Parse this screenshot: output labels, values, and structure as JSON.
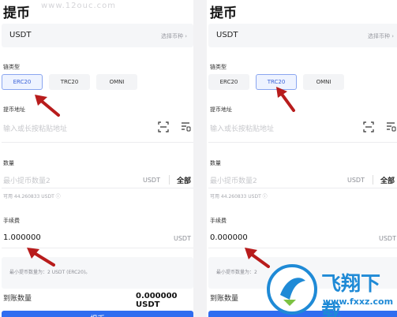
{
  "watermark": "www.12ouc.com",
  "panels": [
    {
      "title": "提币",
      "coin": {
        "value": "USDT",
        "choose_label": "选择币种 ›"
      },
      "chain_label": "链类型",
      "chains": [
        "ERC20",
        "TRC20",
        "OMNI"
      ],
      "active_chain": "ERC20",
      "address_label": "提币地址",
      "address_placeholder": "输入或长按粘贴地址",
      "amount_label": "数量",
      "amount_placeholder": "最小提币数量2",
      "amount_unit": "USDT",
      "all_label": "全部",
      "available_text": "可用 44.260833 USDT ⓘ",
      "fee_label": "手续费",
      "fee_value": "1.000000",
      "fee_unit": "USDT",
      "note_text": "最小提币数量为：2 USDT (ERC20)。",
      "receive_label": "到账数量",
      "receive_value": "0.000000 USDT",
      "submit_label": "提币"
    },
    {
      "title": "提币",
      "coin": {
        "value": "USDT",
        "choose_label": "选择币种 ›"
      },
      "chain_label": "链类型",
      "chains": [
        "ERC20",
        "TRC20",
        "OMNI"
      ],
      "active_chain": "TRC20",
      "address_label": "提币地址",
      "address_placeholder": "输入或长按粘贴地址",
      "amount_label": "数量",
      "amount_placeholder": "最小提币数量2",
      "amount_unit": "USDT",
      "all_label": "全部",
      "available_text": "可用 44.260833 USDT ⓘ",
      "fee_label": "手续费",
      "fee_value": "0.000000",
      "fee_unit": "USDT",
      "note_text": "最小提币数量为：2",
      "receive_label": "到账数量",
      "receive_value": "",
      "submit_label": ""
    }
  ],
  "brand": {
    "name": "飞翔下载",
    "url": "www.fxxz.com"
  },
  "colors": {
    "accent": "#2f6df0",
    "arrow": "#b81c1c",
    "brand": "#1f8ad6"
  }
}
